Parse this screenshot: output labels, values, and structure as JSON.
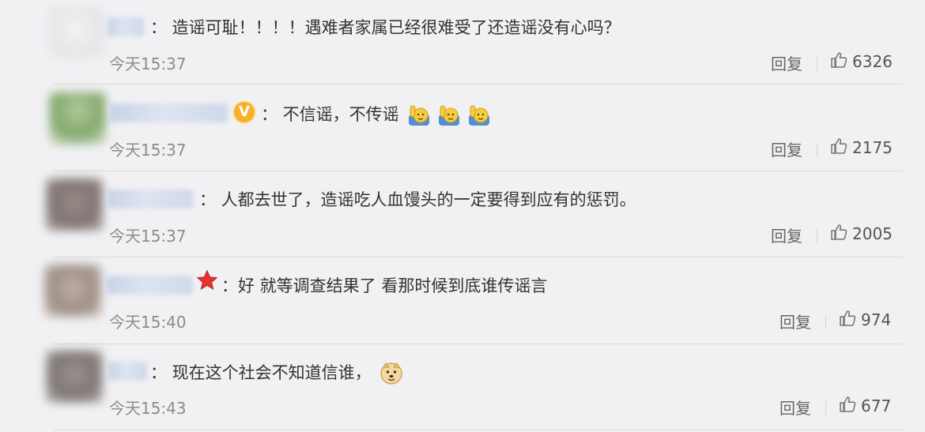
{
  "comments": [
    {
      "text": "：  造谣可耻！！！！遇难者家属已经很难受了还造谣没有心吗？",
      "time": "今天15:37",
      "reply": "回复",
      "likes": "6326"
    },
    {
      "text": "：  不信谣，不传谣",
      "emoji_names": [
        "raised-hand-emoji",
        "raised-hand-emoji",
        "raised-hand-emoji"
      ],
      "time": "今天15:37",
      "reply": "回复",
      "likes": "2175"
    },
    {
      "text": "：  人都去世了，造谣吃人血馒头的一定要得到应有的惩罚。",
      "time": "今天15:37",
      "reply": "回复",
      "likes": "2005"
    },
    {
      "text": "：好 就等调查结果了 看那时候到底谁传谣言",
      "time": "今天15:40",
      "reply": "回复",
      "likes": "974"
    },
    {
      "text": "：  现在这个社会不知道信谁，",
      "emoji_names": [
        "doge-emoji"
      ],
      "time": "今天15:43",
      "reply": "回复",
      "likes": "677"
    }
  ],
  "colors": {
    "background": "#f1f1f4",
    "text": "#333333",
    "time": "#8c8c8c",
    "divider": "#d9d9d9",
    "verified_badge": "#f6b12b",
    "star_badge": "#e5322d"
  },
  "icons": {
    "like": "thumbs-up-icon",
    "verified": "verified-v-badge-icon",
    "member": "red-star-icon"
  }
}
